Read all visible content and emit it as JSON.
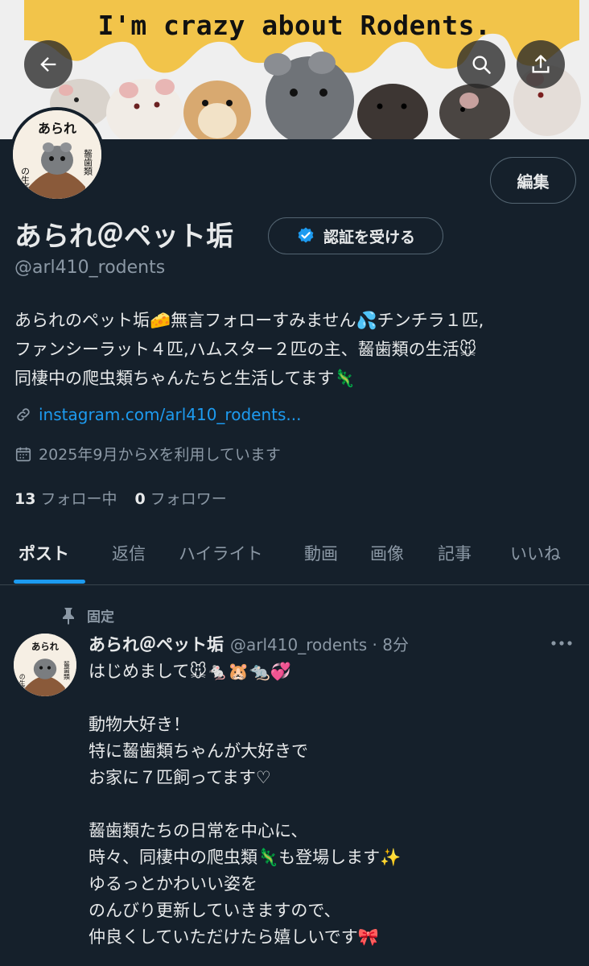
{
  "banner": {
    "title": "I'm crazy about Rodents."
  },
  "profile": {
    "avatar_text": [
      "あられ",
      "の生活",
      "齧歯類"
    ],
    "edit_label": "編集",
    "display_name": "あられ＠ペット垢",
    "verify_label": "認証を受ける",
    "handle": "@arl410_rodents",
    "bio_lines": [
      "あられのペット垢🧀無言フォローすみません💦チンチラ１匹,",
      "ファンシーラット４匹,ハムスター２匹の主、齧歯類の生活🐭",
      "同棲中の爬虫類ちゃんたちと生活してます🦎"
    ],
    "link": "instagram.com/arl410_rodents...",
    "joined": "2025年9月からXを利用しています",
    "following_count": "13",
    "following_label": "フォロー中",
    "followers_count": "0",
    "followers_label": "フォロワー"
  },
  "tabs": [
    "ポスト",
    "返信",
    "ハイライト",
    "動画",
    "画像",
    "記事",
    "いいね"
  ],
  "active_tab": "ポスト",
  "post": {
    "pinned_label": "固定",
    "name": "あられ＠ペット垢",
    "handle_time": "@arl410_rodents · 8分",
    "lines": [
      "はじめまして🐭🐁🐹🐀💞",
      "",
      "動物大好き！",
      "特に齧歯類ちゃんが大好きで",
      "お家に７匹飼ってます♡",
      "",
      "齧歯類たちの日常を中心に、",
      "時々、同棲中の爬虫類🦎も登場します✨",
      "ゆるっとかわいい姿を",
      "のんびり更新していきますので、",
      "仲良くしていただけたら嬉しいです🎀"
    ]
  },
  "colors": {
    "background": "#15202b",
    "accent": "#1d9bf0",
    "muted": "#8b98a5",
    "verified": "#1d9bf0"
  }
}
